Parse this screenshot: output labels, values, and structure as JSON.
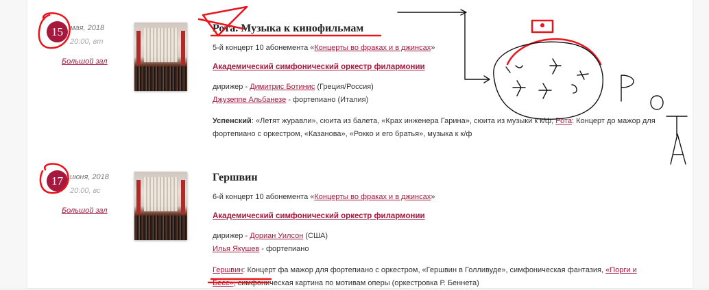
{
  "events": [
    {
      "day": "15",
      "month": "мая, 2018",
      "time": "20:00, вт",
      "hall": "Большой зал",
      "title": "Рота. Музыка к кинофильмам",
      "subscription_prefix": "5-й концерт 10 абонемента «",
      "subscription_link": "Концерты во фраках и в джинсах",
      "subscription_suffix": "»",
      "orchestra": "Академический симфонический оркестр филармонии",
      "line1_prefix": "дирижер - ",
      "line1_link": "Димитрис Ботинис",
      "line1_suffix": " (Греция/Россия)",
      "line2_link": "Джузеппе Альбанезе",
      "line2_suffix": " - фортепиано (Италия)",
      "program_composer1": "Успенский",
      "program_text1": ": «Летят журавли», сюита из балета, «Крах инженера Гарина», сюита из музыки к к/ф; ",
      "program_composer2": "Рота",
      "program_text2": ": Концерт до мажор для фортепиано с оркестром, «Казанова», «Рокко и его братья», музыка к к/ф"
    },
    {
      "day": "17",
      "month": "июня, 2018",
      "time": "20:00, вс",
      "hall": "Большой зал",
      "title": "Гершвин",
      "subscription_prefix": "6-й концерт 10 абонемента «",
      "subscription_link": "Концерты во фраках и в джинсах",
      "subscription_suffix": "»",
      "orchestra": "Академический симфонический оркестр филармонии",
      "line1_prefix": "дирижер - ",
      "line1_link": "Дориан Уилсон",
      "line1_suffix": " (США)",
      "line2_link": "Илья Якушев",
      "line2_suffix": " - фортепиано",
      "program_composer": "Гершвин",
      "program_text1": ": Концерт фа мажор для фортепиано с оркестром, «Гершвин в Голливуде», симфоническая фантазия, ",
      "program_link2": "«Порги и Бесс»",
      "program_text2": ", симфоническая картина по мотивам оперы (оркестровка Р. Беннета)"
    }
  ],
  "annotation_text": "РОТА",
  "colors": {
    "accent": "#a4193d",
    "annotation_red": "#e8141b",
    "annotation_black": "#111111"
  }
}
